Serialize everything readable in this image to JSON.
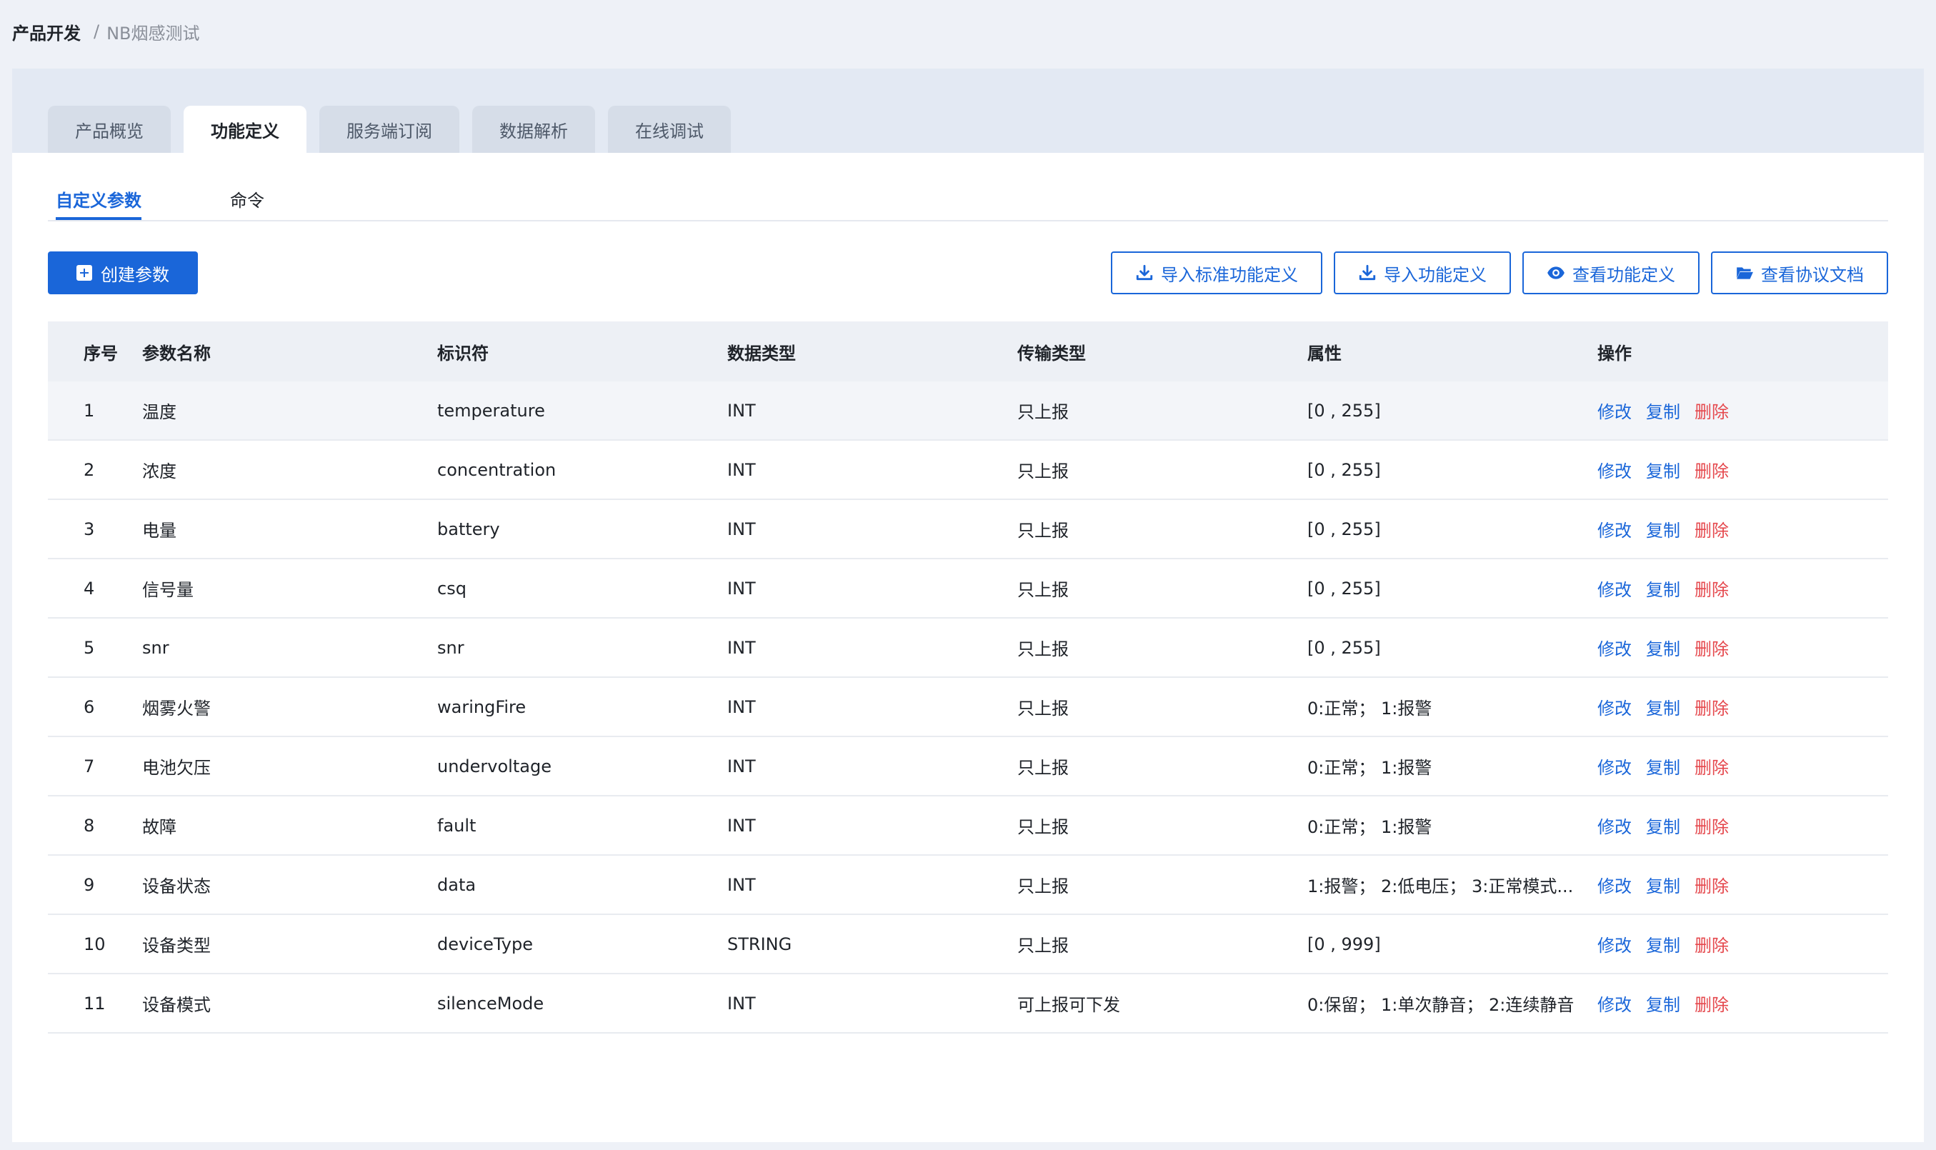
{
  "breadcrumb": {
    "parent": "产品开发",
    "separator": "/",
    "current": "NB烟感测试"
  },
  "tabs": [
    {
      "label": "产品概览"
    },
    {
      "label": "功能定义",
      "active": true
    },
    {
      "label": "服务端订阅"
    },
    {
      "label": "数据解析"
    },
    {
      "label": "在线调试"
    }
  ],
  "subtabs": [
    {
      "label": "自定义参数",
      "active": true
    },
    {
      "label": "命令"
    }
  ],
  "toolbar": {
    "create_label": "创建参数",
    "import_standard_label": "导入标准功能定义",
    "import_label": "导入功能定义",
    "view_definition_label": "查看功能定义",
    "view_protocol_label": "查看协议文档"
  },
  "table": {
    "headers": [
      "序号",
      "参数名称",
      "标识符",
      "数据类型",
      "传输类型",
      "属性",
      "操作"
    ],
    "actions": {
      "edit": "修改",
      "copy": "复制",
      "delete": "删除"
    },
    "rows": [
      [
        "1",
        "温度",
        "temperature",
        "INT",
        "只上报",
        "[0 , 255]"
      ],
      [
        "2",
        "浓度",
        "concentration",
        "INT",
        "只上报",
        "[0 , 255]"
      ],
      [
        "3",
        "电量",
        "battery",
        "INT",
        "只上报",
        "[0 , 255]"
      ],
      [
        "4",
        "信号量",
        "csq",
        "INT",
        "只上报",
        "[0 , 255]"
      ],
      [
        "5",
        "snr",
        "snr",
        "INT",
        "只上报",
        "[0 , 255]"
      ],
      [
        "6",
        "烟雾火警",
        "waringFire",
        "INT",
        "只上报",
        "0:正常； 1:报警"
      ],
      [
        "7",
        "电池欠压",
        "undervoltage",
        "INT",
        "只上报",
        "0:正常； 1:报警"
      ],
      [
        "8",
        "故障",
        "fault",
        "INT",
        "只上报",
        "0:正常； 1:报警"
      ],
      [
        "9",
        "设备状态",
        "data",
        "INT",
        "只上报",
        "1:报警； 2:低电压； 3:正常模式..."
      ],
      [
        "10",
        "设备类型",
        "deviceType",
        "STRING",
        "只上报",
        "[0 , 999]"
      ],
      [
        "11",
        "设备模式",
        "silenceMode",
        "INT",
        "可上报可下发",
        "0:保留； 1:单次静音； 2:连续静音"
      ]
    ]
  },
  "colors": {
    "primary": "#1a66d9",
    "danger": "#e5484d"
  }
}
